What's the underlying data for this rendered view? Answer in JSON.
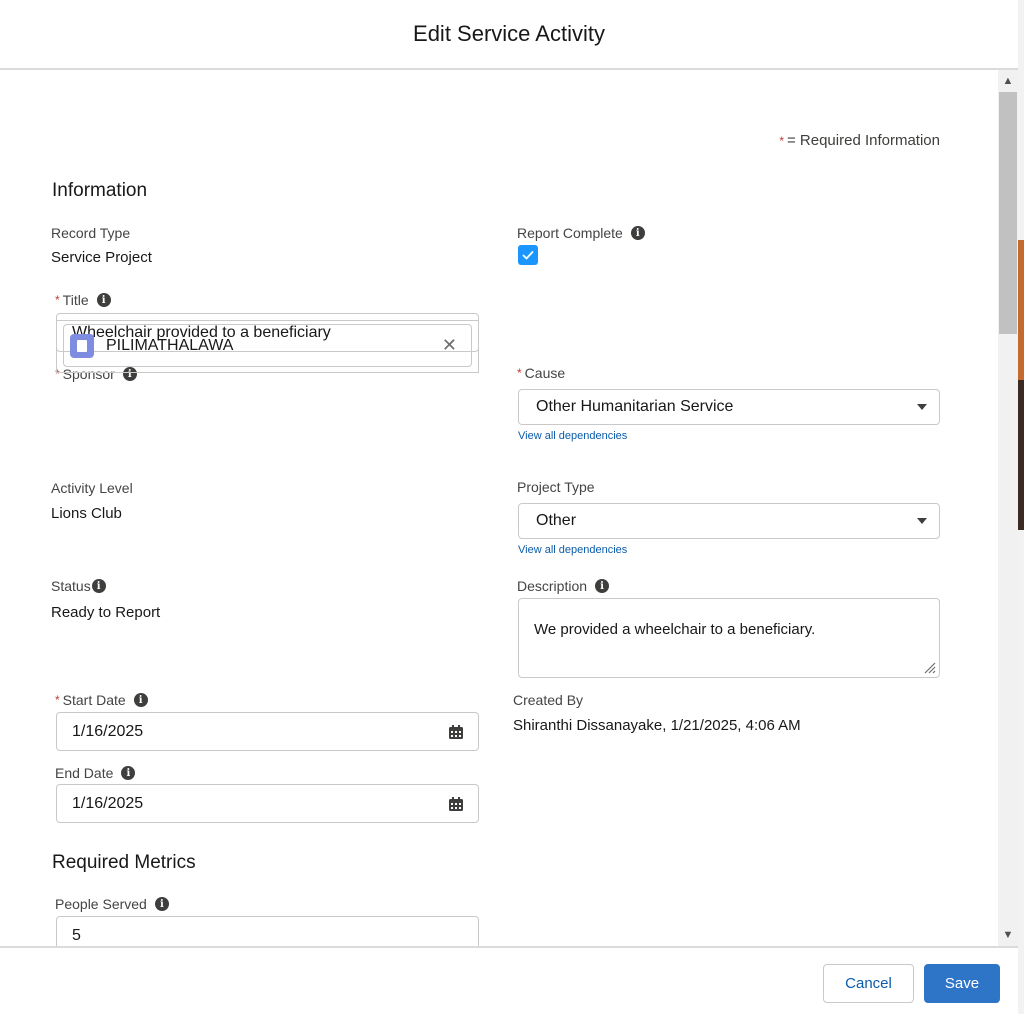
{
  "modal": {
    "title": "Edit Service Activity"
  },
  "legend": {
    "asterisk": "*",
    "text": "= Required Information"
  },
  "sections": {
    "information": "Information",
    "metrics": "Required Metrics"
  },
  "fields": {
    "record_type": {
      "label": "Record Type",
      "value": "Service Project"
    },
    "report_complete": {
      "label": "Report Complete",
      "checked": true
    },
    "title": {
      "label": "Title",
      "value": "Wheelchair provided to a beneficiary"
    },
    "sponsor": {
      "label": "Sponsor",
      "value": "PILIMATHALAWA"
    },
    "cause": {
      "label": "Cause",
      "value": "Other Humanitarian Service",
      "link": "View all dependencies"
    },
    "activity_level": {
      "label": "Activity Level",
      "value": "Lions Club"
    },
    "project_type": {
      "label": "Project Type",
      "value": "Other",
      "link": "View all dependencies"
    },
    "status": {
      "label": "Status",
      "value": "Ready to Report"
    },
    "description": {
      "label": "Description",
      "value": "We provided a wheelchair to a beneficiary."
    },
    "start_date": {
      "label": "Start Date",
      "value": "1/16/2025"
    },
    "created_by": {
      "label": "Created By",
      "value": "Shiranthi Dissanayake, 1/21/2025, 4:06 AM"
    },
    "end_date": {
      "label": "End Date",
      "value": "1/16/2025"
    },
    "people_served": {
      "label": "People Served",
      "value": "5"
    }
  },
  "footer": {
    "cancel": "Cancel",
    "save": "Save"
  },
  "colors": {
    "brand": "#2e74c7",
    "required": "#c23934",
    "link": "#0b5cab",
    "checkbox": "#1b96ff"
  }
}
